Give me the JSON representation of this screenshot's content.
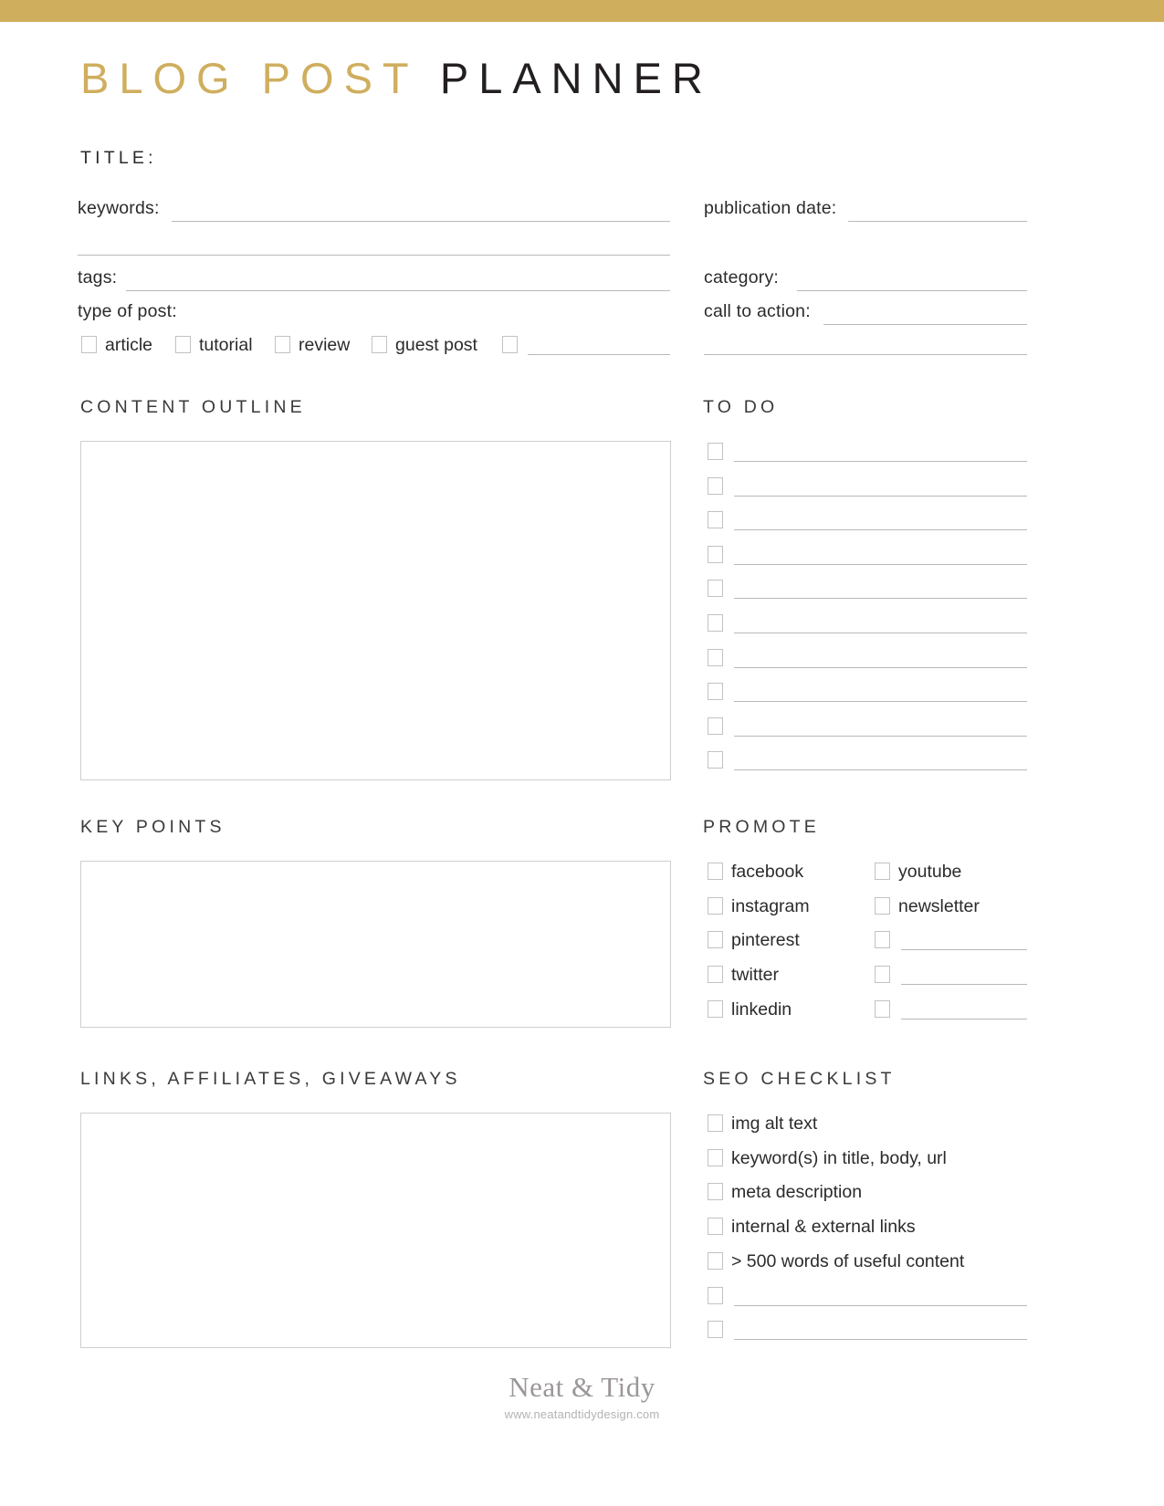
{
  "theme": {
    "gold": "#cfae5e",
    "dark": "#231f20",
    "rule": "#b9b9b9",
    "box_border": "#cfcfcf",
    "checkbox_border": "#c2c2c2",
    "footer_text": "#9b9799"
  },
  "title": {
    "part_gold": "BLOG POST",
    "part_dark": "PLANNER"
  },
  "form": {
    "title_label": "TITLE:",
    "keywords_label": "keywords:",
    "tags_label": "tags:",
    "type_of_post_label": "type of post:",
    "publication_date_label": "publication date:",
    "category_label": "category:",
    "call_to_action_label": "call to action:",
    "type_of_post_options": [
      "article",
      "tutorial",
      "review",
      "guest post"
    ],
    "type_of_post_blank_count": 1
  },
  "sections": {
    "content_outline": "CONTENT OUTLINE",
    "key_points": "KEY POINTS",
    "links_affiliates_giveaways": "LINKS, AFFILIATES, GIVEAWAYS",
    "to_do": "TO DO",
    "promote": "PROMOTE",
    "seo_checklist": "SEO CHECKLIST"
  },
  "to_do": {
    "row_count": 10
  },
  "promote": {
    "left_items": [
      "facebook",
      "instagram",
      "pinterest",
      "twitter",
      "linkedin"
    ],
    "right_items": [
      "youtube",
      "newsletter"
    ],
    "right_blank_count": 3
  },
  "seo_checklist": {
    "items": [
      "img alt text",
      "keyword(s) in title, body, url",
      "meta description",
      "internal & external links",
      "> 500 words of useful content"
    ],
    "blank_count": 2
  },
  "footer": {
    "brand": "Neat & Tidy",
    "url": "www.neatandtidydesign.com"
  }
}
